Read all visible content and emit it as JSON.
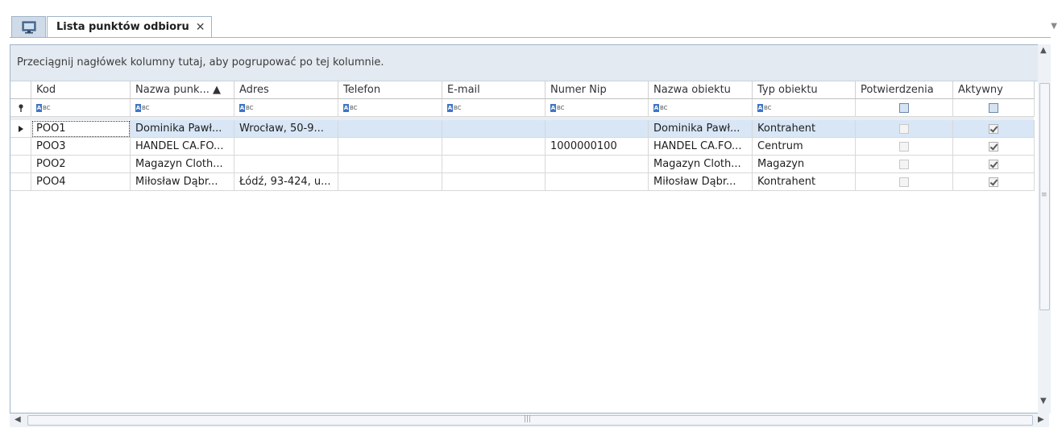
{
  "tab": {
    "title": "Lista punktów odbioru",
    "close": "✕"
  },
  "groupbar": {
    "text": "Przeciągnij nagłówek kolumny tutaj, aby pogrupować po tej kolumnie."
  },
  "columns": [
    {
      "label": "Kod"
    },
    {
      "label": "Nazwa punk... ▲"
    },
    {
      "label": "Adres"
    },
    {
      "label": "Telefon"
    },
    {
      "label": "E-mail"
    },
    {
      "label": "Numer Nip"
    },
    {
      "label": "Nazwa obiektu"
    },
    {
      "label": "Typ obiektu"
    },
    {
      "label": "Potwierdzenia"
    },
    {
      "label": "Aktywny"
    }
  ],
  "rows": [
    {
      "kod": "POO1",
      "nazwa": "Dominika Pawł...",
      "adres": "Wrocław, 50-9...",
      "telefon": "",
      "email": "",
      "nip": "",
      "obiekt": "Dominika Pawł...",
      "typ": "Kontrahent",
      "potwierdzenia": false,
      "aktywny": true
    },
    {
      "kod": "POO3",
      "nazwa": "HANDEL CA.FO...",
      "adres": "",
      "telefon": "",
      "email": "",
      "nip": "1000000100",
      "obiekt": "HANDEL CA.FO...",
      "typ": "Centrum",
      "potwierdzenia": false,
      "aktywny": true
    },
    {
      "kod": "POO2",
      "nazwa": "Magazyn Cloth...",
      "adres": "",
      "telefon": "",
      "email": "",
      "nip": "",
      "obiekt": "Magazyn Cloth...",
      "typ": "Magazyn",
      "potwierdzenia": false,
      "aktywny": true
    },
    {
      "kod": "POO4",
      "nazwa": "Miłosław Dąbr...",
      "adres": "Łódź, 93-424, u...",
      "telefon": "",
      "email": "",
      "nip": "",
      "obiekt": "Miłosław Dąbr...",
      "typ": "Kontrahent",
      "potwierdzenia": false,
      "aktywny": true
    }
  ],
  "icons": {
    "app": "monitor-icon",
    "filter_pin": "pin-icon",
    "text_filter": "abc-filter-icon",
    "row_indicator": "triangle-right-icon"
  },
  "colors": {
    "tab_border": "#9fb4c9",
    "group_bar": "#e4eaf1",
    "selected_row": "#d8e6f6"
  }
}
